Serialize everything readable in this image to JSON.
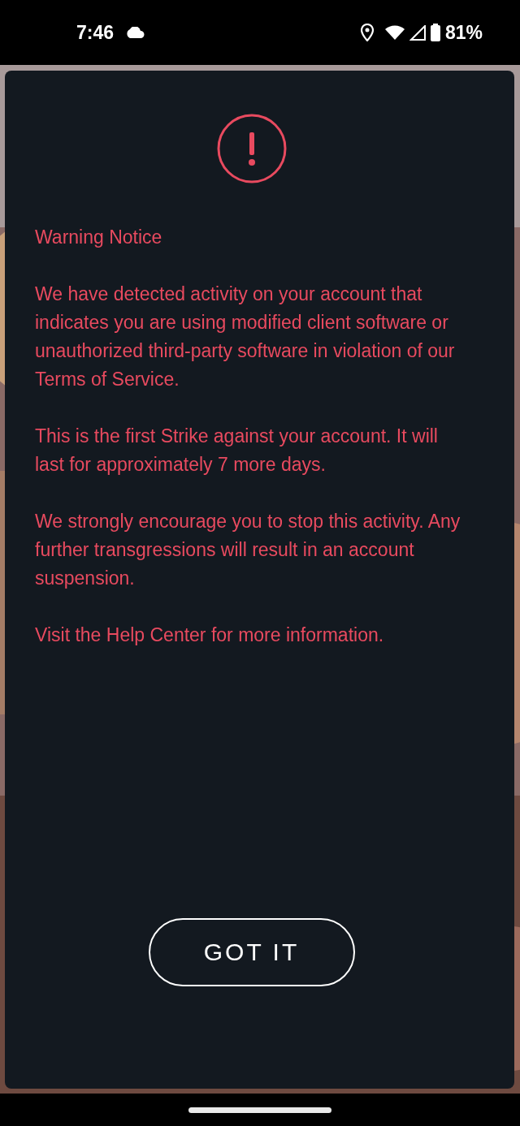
{
  "status_bar": {
    "time": "7:46",
    "battery": "81%"
  },
  "dialog": {
    "title": "Warning Notice",
    "paragraphs": [
      {
        "before": "We have detected activity on your account that indicates you are using modified client software or unauthorized third-party software in violation of our ",
        "link": "Terms of Service",
        "after": "."
      },
      {
        "before": "This is the first Strike against your account. It will last for approximately 7 more days."
      },
      {
        "before": "We strongly encourage you to stop this activity. Any further transgressions will result in an account suspension."
      },
      {
        "before": "Visit the ",
        "link": "Help Center",
        "after": " for more information."
      }
    ],
    "button": "GOT IT"
  }
}
